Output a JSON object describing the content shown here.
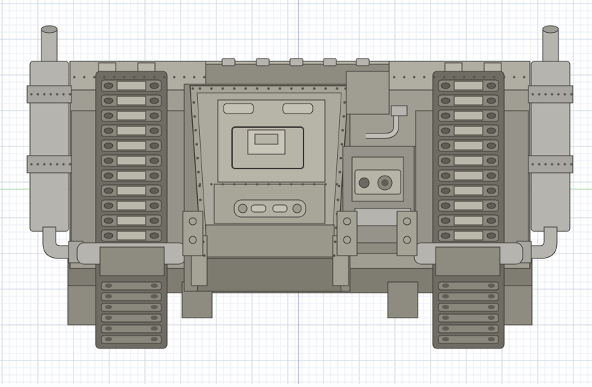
{
  "viewport": {
    "background": "#ffffff",
    "grid_minor_color": "#e8edf3",
    "grid_major_color": "#cdd6e1",
    "axis_vertical_color": "#8f8fe6",
    "axis_horizontal_color": "#9fd59f"
  },
  "model": {
    "icon": "tank-rear-view-icon",
    "hull_color": "#a09d92",
    "hull_dark": "#6f6c63",
    "hull_light": "#bab7ab",
    "panel_color": "#8e8b80",
    "edge_color": "#3d3b36",
    "rivet_color": "#55534c",
    "metal_color": "#b5b4ae",
    "track_color": "#8a877c",
    "shadow_color": "#5f5d56"
  }
}
